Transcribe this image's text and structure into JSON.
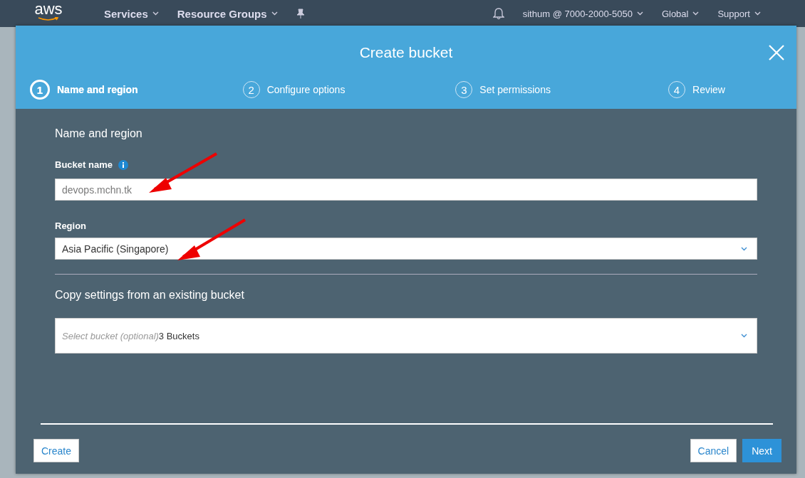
{
  "nav": {
    "logo": "aws",
    "menus": [
      "Services",
      "Resource Groups"
    ],
    "account": "sithum @ 7000-2000-5050",
    "region": "Global",
    "support": "Support"
  },
  "modal": {
    "title": "Create bucket",
    "steps": [
      {
        "number": "1",
        "label": "Name and region",
        "selected": true
      },
      {
        "number": "2",
        "label": "Configure options",
        "selected": false
      },
      {
        "number": "3",
        "label": "Set permissions",
        "selected": false
      },
      {
        "number": "4",
        "label": "Review",
        "selected": false
      }
    ],
    "section_title": "Name and region",
    "bucket_name": {
      "label": "Bucket name",
      "placeholder": "devops.mchn.tk"
    },
    "region": {
      "label": "Region",
      "value": "Asia Pacific (Singapore)"
    },
    "copy_section_title": "Copy settings from an existing bucket",
    "copy_select": {
      "placeholder": "Select bucket (optional)",
      "value": "3 Buckets"
    },
    "buttons": [
      {
        "label": "Create",
        "kind": "secondary"
      },
      {
        "label": "Cancel",
        "kind": "secondary"
      },
      {
        "label": "Next",
        "kind": "primary"
      }
    ]
  }
}
